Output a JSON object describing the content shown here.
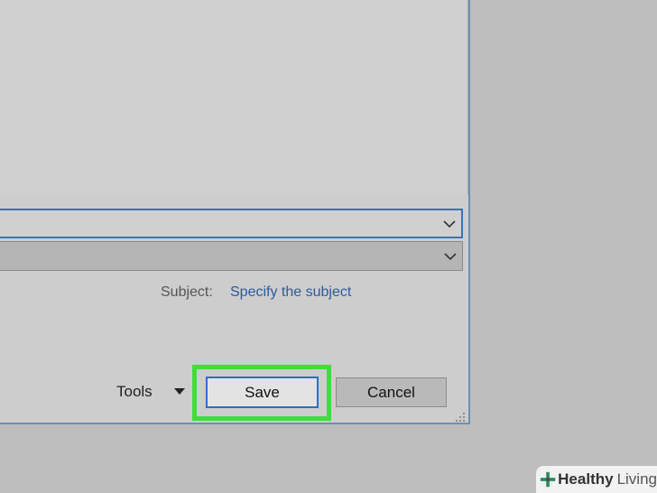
{
  "dialog": {
    "subject_label": "Subject:",
    "subject_placeholder": "Specify the subject",
    "tools_label": "Tools",
    "save_label": "Save",
    "cancel_label": "Cancel"
  },
  "highlight_color": "#3be03b",
  "accent_color": "#2f6fc0",
  "watermark": {
    "brand_bold": "Healthy",
    "brand_light": "Living"
  }
}
